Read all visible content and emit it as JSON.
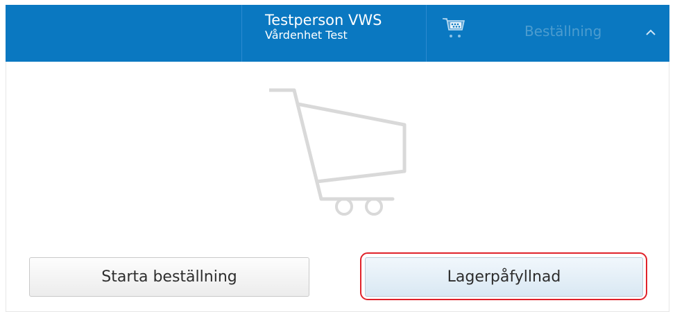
{
  "header": {
    "user_name": "Testperson VWS",
    "care_unit": "Vårdenhet Test",
    "cart_icon": "cart-icon",
    "order_label": "Beställning",
    "collapse_icon": "chevron-up-icon"
  },
  "main": {
    "empty_cart_icon": "empty-cart-icon",
    "start_order_label": "Starta beställning",
    "restock_label": "Lagerpåfyllnad"
  },
  "colors": {
    "header_bg": "#0a78c1",
    "highlight": "#e0222a"
  }
}
